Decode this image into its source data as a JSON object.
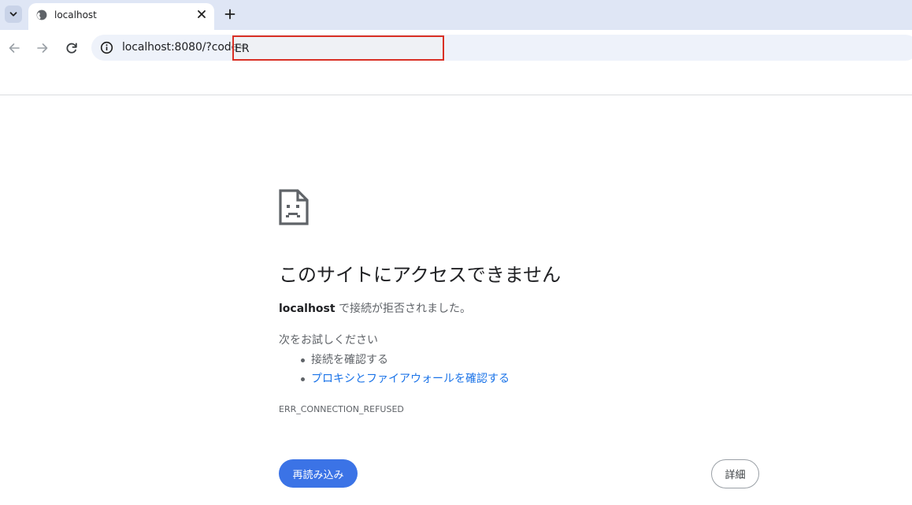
{
  "tab": {
    "title": "localhost"
  },
  "address_bar": {
    "url_prefix": "localhost:8080/?code=",
    "url_highlighted": "ER"
  },
  "error_page": {
    "heading": "このサイトにアクセスできません",
    "host": "localhost",
    "summary_rest": " で接続が拒否されました。",
    "suggestions_title": "次をお試しください",
    "suggestions": [
      "接続を確認する",
      "プロキシとファイアウォールを確認する"
    ],
    "error_code": "ERR_CONNECTION_REFUSED",
    "reload_label": "再読み込み",
    "details_label": "詳細"
  },
  "colors": {
    "tab_strip_bg": "#dfe6f5",
    "omnibox_bg": "#eef2fa",
    "highlight_border": "#d93025",
    "link": "#1a73e8",
    "primary_button": "#3b73e6"
  },
  "icons": {
    "tab_search": "chevron-down-icon",
    "favicon": "globe-icon",
    "tab_close": "close-icon",
    "new_tab": "plus-icon",
    "back": "arrow-left-icon",
    "forward": "arrow-right-icon",
    "reload": "reload-icon",
    "site_info": "info-icon",
    "error": "sad-page-icon"
  }
}
